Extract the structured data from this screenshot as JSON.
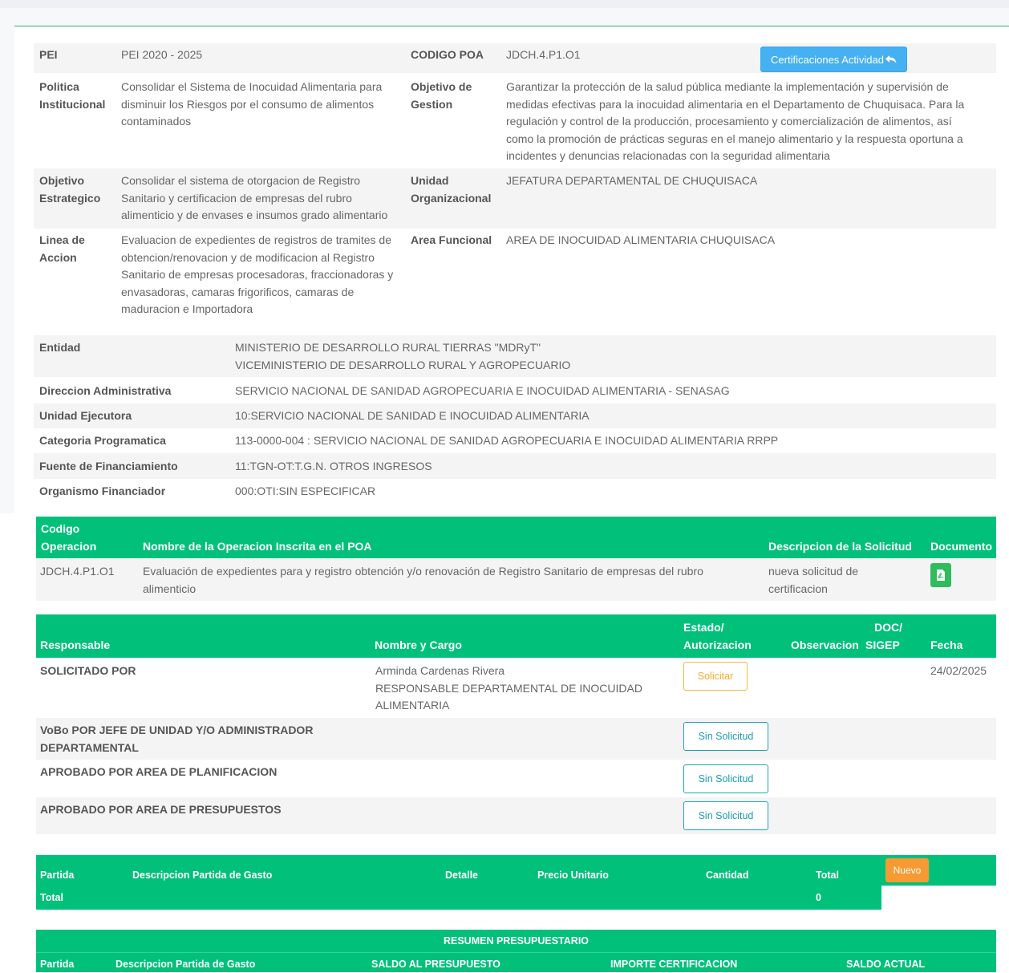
{
  "info": {
    "pei_label": "PEI",
    "pei_value": "PEI 2020 - 2025",
    "codigo_poa_label": "CODIGO POA",
    "codigo_poa_value": "JDCH.4.P1.O1",
    "cert_button": "Certificaciones Actividad",
    "politica_label_1": "Politica",
    "politica_label_2": "Institucional",
    "politica_value": [
      "Consolidar el Sistema de Inocuidad Alimentaria para",
      "disminuir los Riesgos por el consumo de alimentos",
      "contaminados"
    ],
    "objetivo_gestion_label_1": "Objetivo de",
    "objetivo_gestion_label_2": "Gestion",
    "objetivo_gestion_value": [
      "Garantizar la protección de la salud pública mediante la implementación y supervisión de",
      "medidas efectivas para la inocuidad alimentaria en el Departamento de Chuquisaca. Para la",
      "regulación y control de la producción, procesamiento y comercialización de alimentos, así",
      "como la promoción de prácticas seguras en el manejo alimentario y la respuesta oportuna a",
      "incidentes y denuncias relacionadas con la seguridad alimentaria"
    ],
    "objetivo_estrategico_label_1": "Objetivo",
    "objetivo_estrategico_label_2": "Estrategico",
    "objetivo_estrategico_value": [
      "Consolidar el sistema de otorgacion de Registro",
      "Sanitario y certificacion de empresas del rubro",
      "alimenticio y de envases e insumos grado alimentario"
    ],
    "unidad_org_label_1": "Unidad",
    "unidad_org_label_2": "Organizacional",
    "unidad_org_value": "JEFATURA DEPARTAMENTAL DE CHUQUISACA",
    "linea_label_1": "Linea de",
    "linea_label_2": "Accion",
    "linea_value": [
      "Evaluacion de expedientes de registros de tramites de",
      "obtencion/renovacion y de modificacion al Registro",
      "Sanitario de empresas procesadoras, fraccionadoras y",
      "envasadoras, camaras frigorificos, camaras de",
      "maduracion e Importadora"
    ],
    "area_funcional_label": "Area Funcional",
    "area_funcional_value": "AREA DE INOCUIDAD ALIMENTARIA CHUQUISACA",
    "entidad_label": "Entidad",
    "entidad_value_1": "MINISTERIO DE DESARROLLO RURAL TIERRAS \"MDRyT\"",
    "entidad_value_2": "VICEMINISTERIO DE DESARROLLO RURAL Y AGROPECUARIO",
    "direccion_label": "Direccion Administrativa",
    "direccion_value": "SERVICIO NACIONAL DE SANIDAD AGROPECUARIA E INOCUIDAD ALIMENTARIA - SENASAG",
    "unidad_ejec_label": "Unidad Ejecutora",
    "unidad_ejec_value": "10:SERVICIO NACIONAL DE SANIDAD E INOCUIDAD ALIMENTARIA",
    "categoria_label": "Categoria Programatica",
    "categoria_value": "113-0000-004 : SERVICIO NACIONAL DE SANIDAD AGROPECUARIA E INOCUIDAD ALIMENTARIA RRPP",
    "fuente_label": "Fuente de Financiamiento",
    "fuente_value": "11:TGN-OT:T.G.N. OTROS INGRESOS",
    "organismo_label": "Organismo Financiador",
    "organismo_value": "000:OTI:SIN ESPECIFICAR"
  },
  "operacion_table": {
    "h_codigo_1": "Codigo",
    "h_codigo_2": "Operacion",
    "h_nombre": "Nombre de la Operacion Inscrita en el POA",
    "h_descripcion": "Descripcion de la Solicitud",
    "h_documento": "Documento",
    "row_codigo": "JDCH.4.P1.O1",
    "row_nombre_1": "Evaluación de expedientes para y registro obtención y/o renovación de Registro Sanitario de empresas del rubro",
    "row_nombre_2": "alimenticio",
    "row_desc_1": "nueva solicitud de",
    "row_desc_2": "certificacion"
  },
  "aprobacion_table": {
    "h_responsable": "Responsable",
    "h_nombre_cargo": "Nombre y Cargo",
    "h_estado_1": "Estado/",
    "h_estado_2": "Autorizacion",
    "h_observacion": "Observacion",
    "h_doc_1": "DOC/",
    "h_doc_2": "SIGEP",
    "h_fecha": "Fecha",
    "rows": [
      {
        "responsable": "SOLICITADO POR",
        "nombre": "Arminda Cardenas Rivera",
        "cargo_1": "RESPONSABLE DEPARTAMENTAL DE INOCUIDAD",
        "cargo_2": "ALIMENTARIA",
        "estado": "Solicitar",
        "fecha": "24/02/2025"
      },
      {
        "responsable_1": "VoBo POR JEFE DE UNIDAD Y/O ADMINISTRADOR",
        "responsable_2": "DEPARTAMENTAL",
        "estado": "Sin Solicitud"
      },
      {
        "responsable": "APROBADO POR AREA DE PLANIFICACION",
        "estado": "Sin Solicitud"
      },
      {
        "responsable": "APROBADO POR AREA DE PRESUPUESTOS",
        "estado": "Sin Solicitud"
      }
    ]
  },
  "partida_table": {
    "h_partida": "Partida",
    "h_descripcion": "Descripcion Partida de Gasto",
    "h_detalle": "Detalle",
    "h_precio": "Precio Unitario",
    "h_cantidad": "Cantidad",
    "h_total": "Total",
    "nuevo_button": "Nuevo",
    "total_label": "Total",
    "total_value": "0"
  },
  "resumen_table": {
    "title": "RESUMEN PRESUPUESTARIO",
    "h_partida": "Partida",
    "h_descripcion": "Descripcion Partida de Gasto",
    "h_saldo_presupuesto": "SALDO AL PRESUPUESTO",
    "h_importe": "IMPORTE CERTIFICACION",
    "h_saldo_actual": "SALDO ACTUAL"
  },
  "colors": {
    "primary_green": "#00c07a",
    "info_blue": "#45b0f2",
    "warning": "#f0ad2a",
    "teal": "#1b9cb1",
    "orange": "#f79a33"
  }
}
